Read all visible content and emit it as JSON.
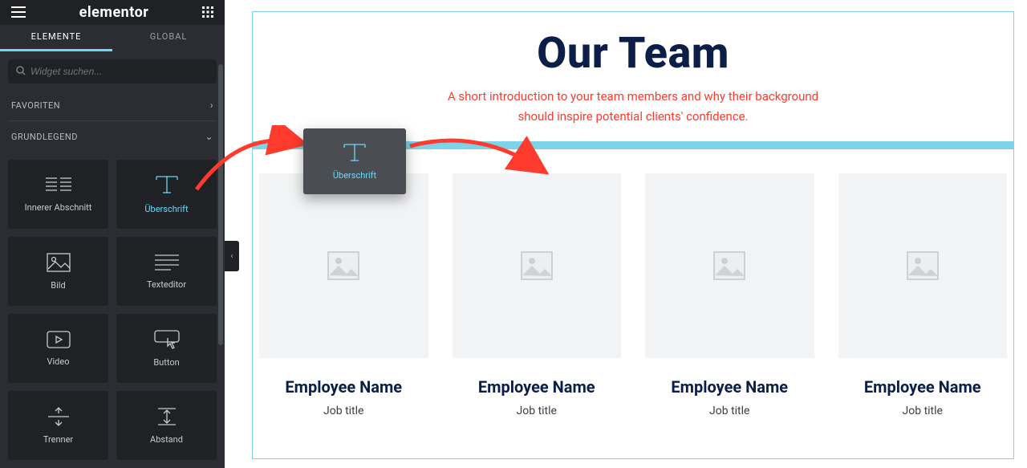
{
  "brand": "elementor",
  "tabs": {
    "elemente": "ELEMENTE",
    "global": "GLOBAL"
  },
  "search": {
    "placeholder": "Widget suchen..."
  },
  "sections": {
    "favoriten": "FAVORITEN",
    "grundlegend": "GRUNDLEGEND"
  },
  "widgets": {
    "innerer_abschnitt": "Innerer Abschnitt",
    "ueberschrift": "Überschrift",
    "bild": "Bild",
    "texteditor": "Texteditor",
    "video": "Video",
    "button": "Button",
    "trenner": "Trenner",
    "abstand": "Abstand"
  },
  "drag_preview": "Überschrift",
  "hero": {
    "title": "Our Team",
    "subtitle": "A short introduction to your team members and why their background should inspire potential clients' confidence."
  },
  "team": [
    {
      "name": "Employee Name",
      "title": "Job title"
    },
    {
      "name": "Employee Name",
      "title": "Job title"
    },
    {
      "name": "Employee Name",
      "title": "Job title"
    },
    {
      "name": "Employee Name",
      "title": "Job title"
    }
  ]
}
